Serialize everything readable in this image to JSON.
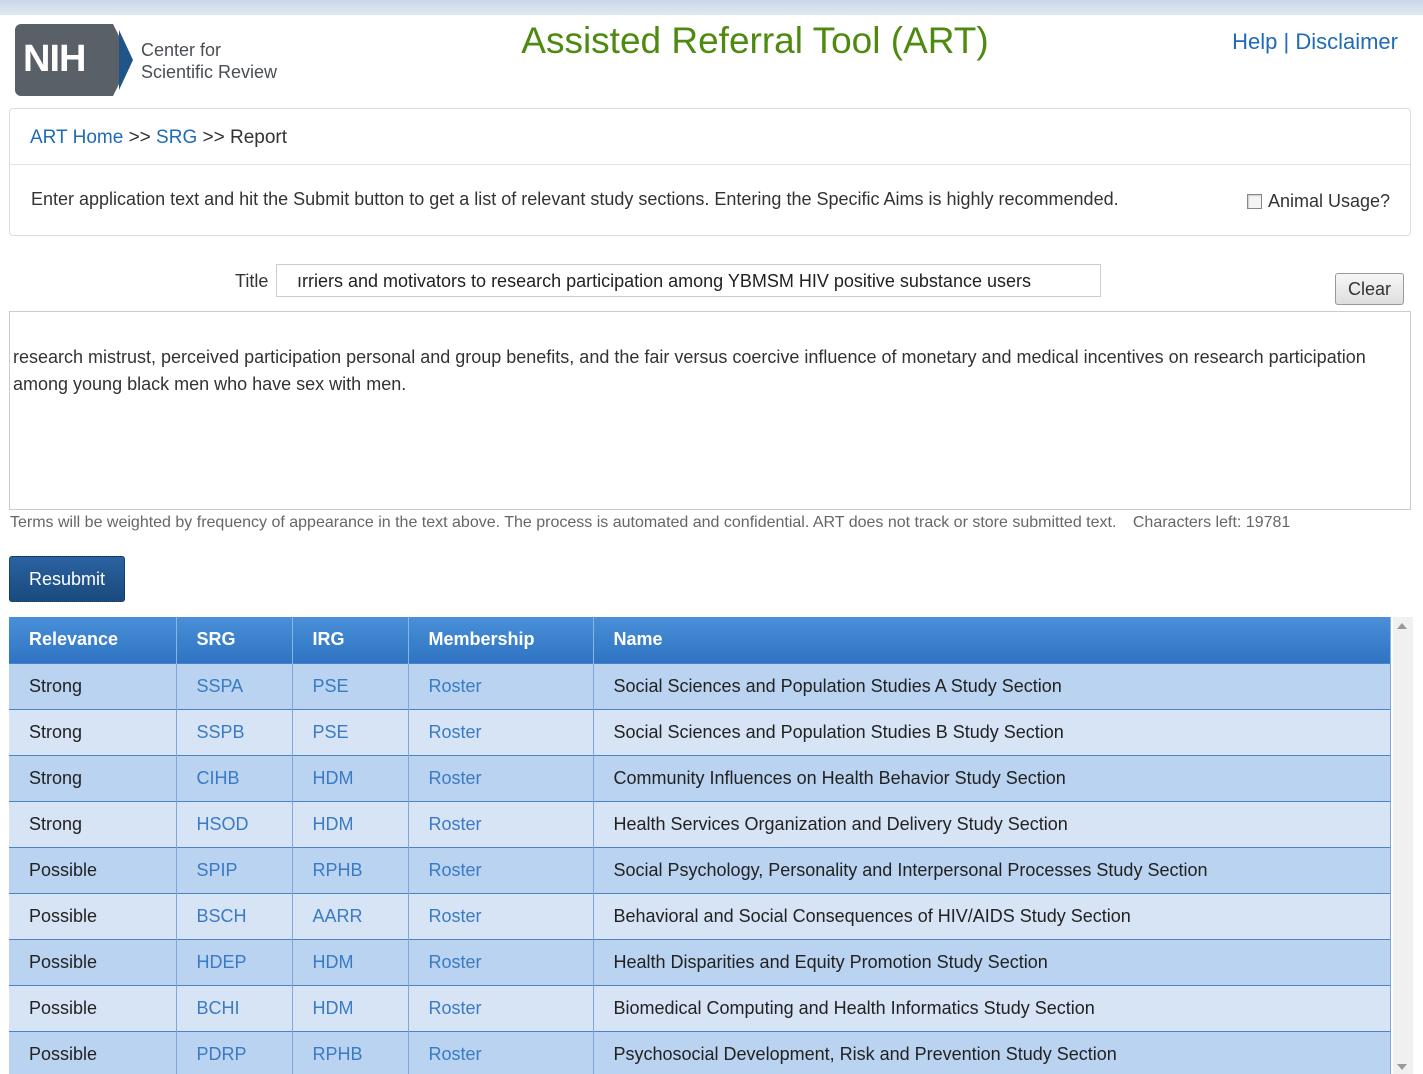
{
  "header": {
    "logo_text": "NIH",
    "org_line1": "Center for",
    "org_line2": "Scientific Review",
    "app_title": "Assisted Referral Tool (ART)",
    "help_link": "Help",
    "separator": "|",
    "disclaimer_link": "Disclaimer"
  },
  "breadcrumb": {
    "home": "ART Home",
    "sep1": ">>",
    "srg": "SRG",
    "sep2": ">>",
    "current": "Report"
  },
  "instructions": "Enter application text and hit the Submit button to get a list of relevant study sections. Entering the Specific Aims is highly recommended.",
  "animal_usage_label": "Animal Usage?",
  "form": {
    "title_label": "Title",
    "title_value": "ırriers and motivators to research participation among YBMSM HIV positive substance users",
    "clear_label": "Clear",
    "body_text": "research mistrust, perceived participation personal and group benefits, and the fair versus coercive influence of monetary and medical incentives on research participation among young black men who have sex with men.",
    "terms_note": "Terms will be weighted by frequency of appearance in the text above. The process is automated and confidential. ART does not track or store submitted text.",
    "chars_left": "Characters left: 19781",
    "resubmit_label": "Resubmit"
  },
  "results": {
    "columns": [
      "Relevance",
      "SRG",
      "IRG",
      "Membership",
      "Name"
    ],
    "rows": [
      [
        "Strong",
        "SSPA",
        "PSE",
        "Roster",
        "Social Sciences and Population Studies A Study Section"
      ],
      [
        "Strong",
        "SSPB",
        "PSE",
        "Roster",
        "Social Sciences and Population Studies B Study Section"
      ],
      [
        "Strong",
        "CIHB",
        "HDM",
        "Roster",
        "Community Influences on Health Behavior Study Section"
      ],
      [
        "Strong",
        "HSOD",
        "HDM",
        "Roster",
        "Health Services Organization and Delivery Study Section"
      ],
      [
        "Possible",
        "SPIP",
        "RPHB",
        "Roster",
        "Social Psychology, Personality and Interpersonal Processes Study Section"
      ],
      [
        "Possible",
        "BSCH",
        "AARR",
        "Roster",
        "Behavioral and Social Consequences of HIV/AIDS Study Section"
      ],
      [
        "Possible",
        "HDEP",
        "HDM",
        "Roster",
        "Health Disparities and Equity Promotion Study Section"
      ],
      [
        "Possible",
        "BCHI",
        "HDM",
        "Roster",
        "Biomedical Computing and Health Informatics Study Section"
      ],
      [
        "Possible",
        "PDRP",
        "RPHB",
        "Roster",
        "Psychosocial Development, Risk and Prevention Study Section"
      ]
    ]
  },
  "colors": {
    "title_green": "#4f8a10",
    "link_blue": "#1f6bb8",
    "header_blue": "#2f74c2",
    "row_odd": "#b9d3f0",
    "row_even": "#d6e4f5"
  }
}
